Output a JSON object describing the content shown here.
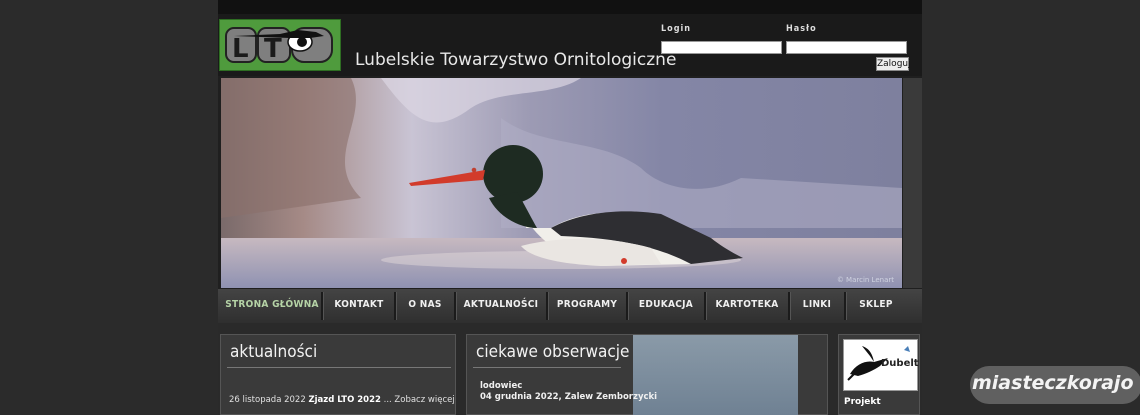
{
  "header": {
    "logo_text": "LTO",
    "site_title": "Lubelskie Towarzystwo Ornitologiczne"
  },
  "login": {
    "login_label": "Login",
    "password_label": "Hasło",
    "login_value": "",
    "password_value": "",
    "submit_label": "Zaloguj"
  },
  "hero": {
    "photo_credit": "© Marcin Lenart"
  },
  "nav": {
    "items": [
      {
        "label": "STRONA GŁÓWNA",
        "active": true
      },
      {
        "label": "KONTAKT",
        "active": false
      },
      {
        "label": "O NAS",
        "active": false
      },
      {
        "label": "AKTUALNOŚCI",
        "active": false
      },
      {
        "label": "PROGRAMY",
        "active": false
      },
      {
        "label": "EDUKACJA",
        "active": false
      },
      {
        "label": "KARTOTEKA",
        "active": false
      },
      {
        "label": "LINKI",
        "active": false
      },
      {
        "label": "SKLEP",
        "active": false
      }
    ]
  },
  "news": {
    "title": "aktualności",
    "date": "26 listopada 2022",
    "headline": "Zjazd LTO 2022",
    "more": " ... Zobacz więcej"
  },
  "observations": {
    "title": "ciekawe obserwacje",
    "species": "lodowiec",
    "date_place": "04 grudnia 2022, Zalew Zemborzycki"
  },
  "sidebar": {
    "dubelt_label": "Dubelt",
    "project_label": "Projekt"
  },
  "watermark": {
    "text": "miasteczkorajo"
  },
  "colors": {
    "logo_green": "#4f9b3d",
    "nav_active": "#b5d3a6",
    "page_bg": "#2b2b2b"
  }
}
